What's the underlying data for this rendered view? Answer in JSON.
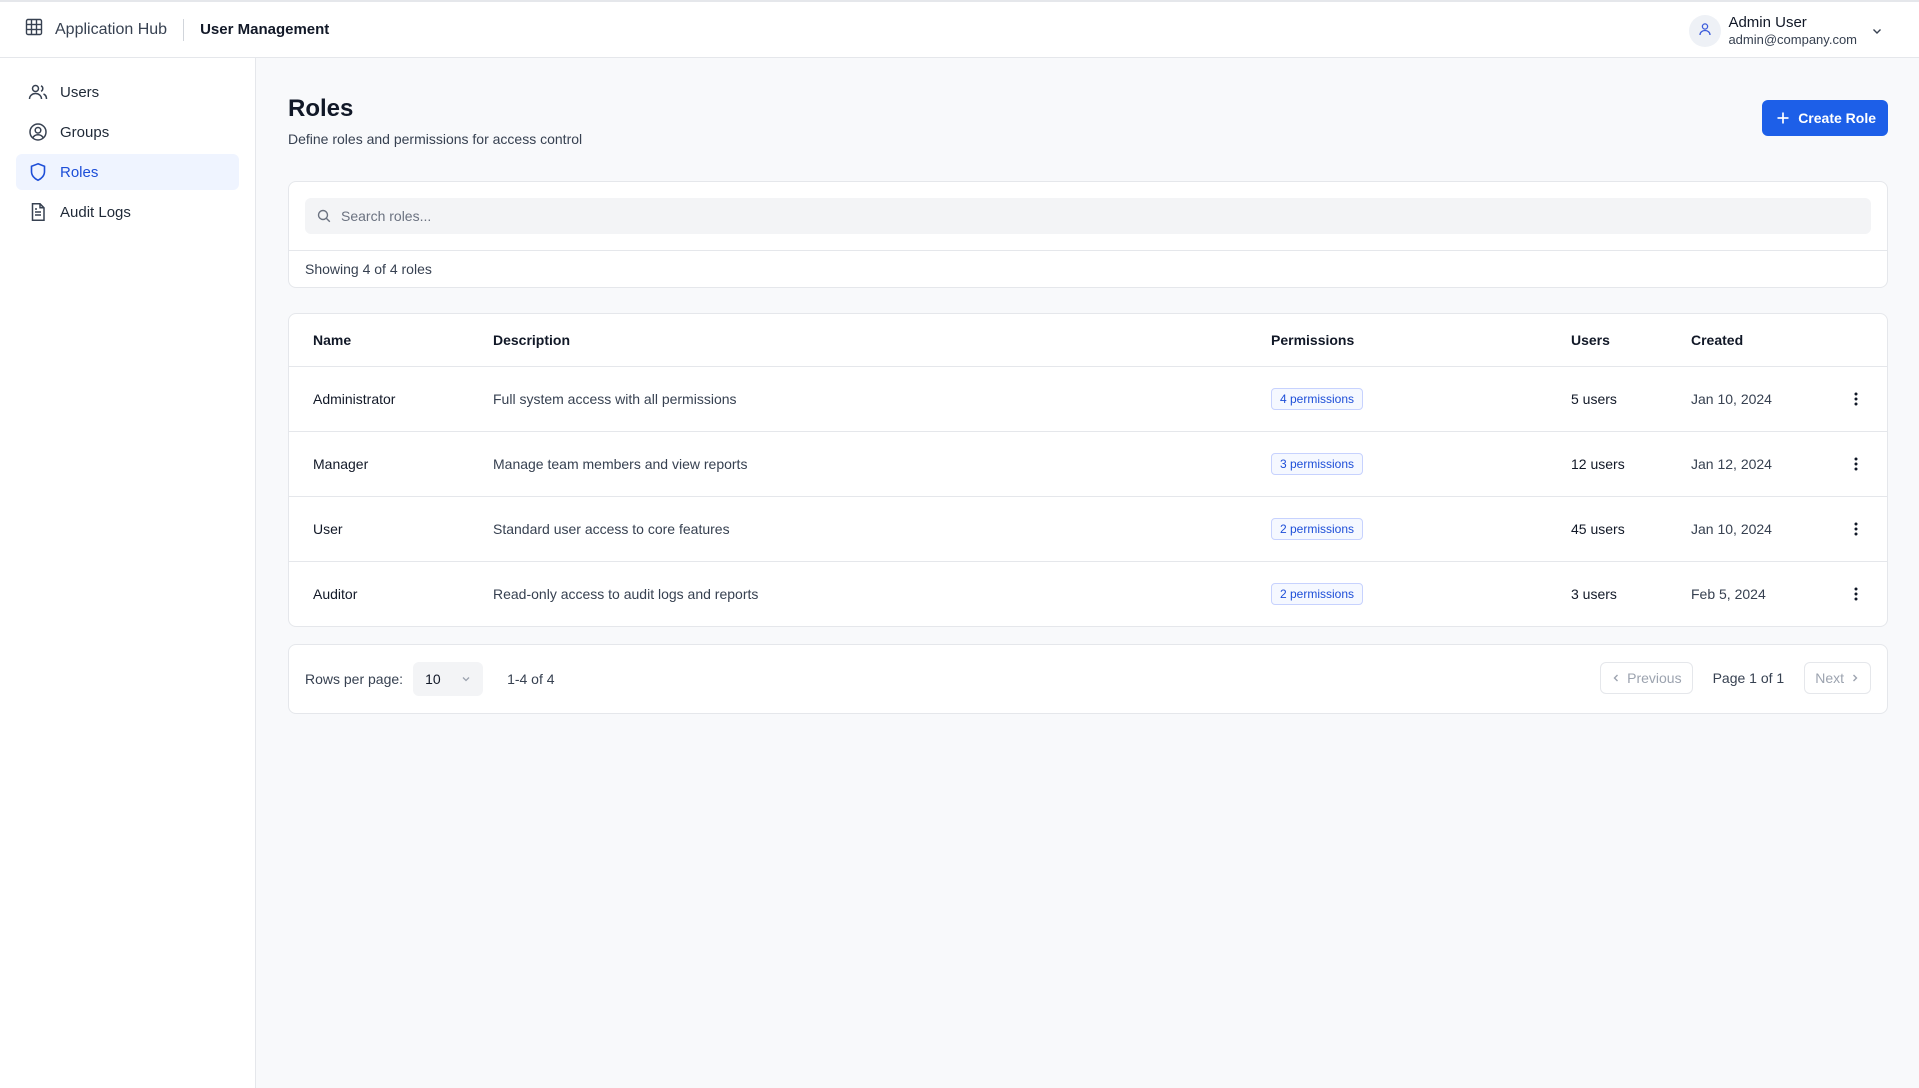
{
  "topbar": {
    "app_name": "Application Hub",
    "section_name": "User Management",
    "user_name": "Admin User",
    "user_email": "admin@company.com"
  },
  "sidebar": {
    "items": [
      {
        "label": "Users",
        "icon": "users-icon",
        "active": false
      },
      {
        "label": "Groups",
        "icon": "user-circle-icon",
        "active": false
      },
      {
        "label": "Roles",
        "icon": "shield-icon",
        "active": true
      },
      {
        "label": "Audit Logs",
        "icon": "document-icon",
        "active": false
      }
    ]
  },
  "page": {
    "title": "Roles",
    "subtitle": "Define roles and permissions for access control",
    "create_label": "Create Role"
  },
  "search": {
    "placeholder": "Search roles...",
    "value": "",
    "showing_text": "Showing 4 of 4 roles"
  },
  "table": {
    "headers": {
      "name": "Name",
      "description": "Description",
      "permissions": "Permissions",
      "users": "Users",
      "created": "Created"
    },
    "rows": [
      {
        "name": "Administrator",
        "description": "Full system access with all permissions",
        "permissions": "4 permissions",
        "users": "5 users",
        "created": "Jan 10, 2024"
      },
      {
        "name": "Manager",
        "description": "Manage team members and view reports",
        "permissions": "3 permissions",
        "users": "12 users",
        "created": "Jan 12, 2024"
      },
      {
        "name": "User",
        "description": "Standard user access to core features",
        "permissions": "2 permissions",
        "users": "45 users",
        "created": "Jan 10, 2024"
      },
      {
        "name": "Auditor",
        "description": "Read-only access to audit logs and reports",
        "permissions": "2 permissions",
        "users": "3 users",
        "created": "Feb 5, 2024"
      }
    ]
  },
  "pagination": {
    "rows_label": "Rows per page:",
    "rows_value": "10",
    "range": "1-4 of 4",
    "previous_label": "Previous",
    "page_info": "Page 1 of 1",
    "next_label": "Next"
  },
  "colors": {
    "accent": "#1d5fe8",
    "active_nav_bg": "#eff4ff",
    "active_nav_text": "#1d4ed8",
    "background": "#f8f9fb"
  }
}
